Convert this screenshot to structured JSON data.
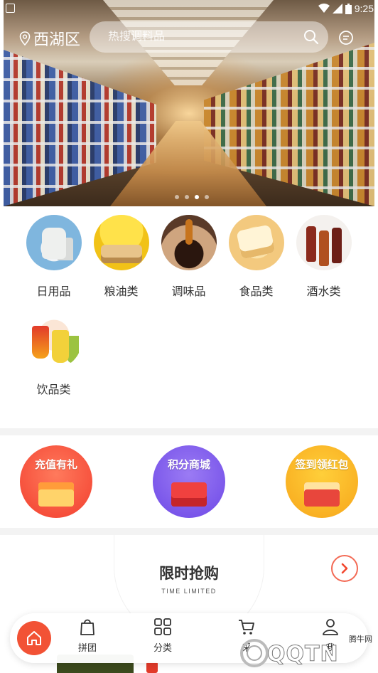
{
  "status_bar": {
    "time": "9:25"
  },
  "header": {
    "location": "西湖区",
    "search_placeholder": "热搜调料品"
  },
  "banner": {
    "dot_count": 4,
    "active_dot": 3
  },
  "categories": [
    {
      "label": "日用品"
    },
    {
      "label": "粮油类"
    },
    {
      "label": "调味品"
    },
    {
      "label": "食品类"
    },
    {
      "label": "酒水类"
    },
    {
      "label": "饮品类"
    }
  ],
  "promos": [
    {
      "title": "充值有礼"
    },
    {
      "title": "积分商城"
    },
    {
      "title": "签到领红包"
    }
  ],
  "flash_sale": {
    "title": "限时抢购",
    "subtitle": "TIME LIMITED"
  },
  "bottom_nav": {
    "items": [
      {
        "label": "拼团"
      },
      {
        "label": "分类"
      },
      {
        "label": "采"
      },
      {
        "label": "我"
      }
    ]
  },
  "watermark": {
    "brand": "QQTN",
    "site": "腾牛网"
  }
}
